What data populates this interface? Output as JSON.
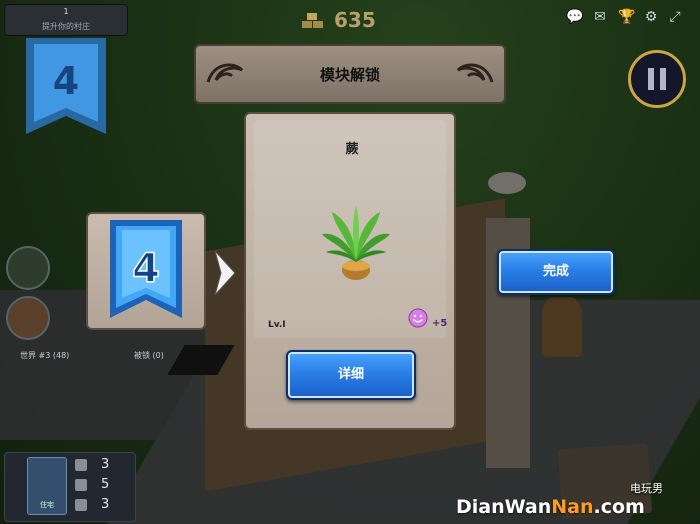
{
  "hud": {
    "level_text": "1",
    "progress_text": "提升你的村庄",
    "coin_amount": "635",
    "icons": [
      "chat-icon",
      "mail-icon",
      "trophy-icon",
      "gear-icon",
      "expand-icon"
    ],
    "timer_icon": "pause-icon"
  },
  "side": {
    "ribbon_level": "4",
    "stats_left": "世界 #3 (48)",
    "stats_right": "被锁 (0)"
  },
  "bottom_panel": {
    "label": "住宅",
    "counts": [
      "3",
      "5",
      "3"
    ]
  },
  "modal": {
    "title": "模块解锁",
    "unlock_level": "4",
    "item_name": "蕨",
    "item_level": "Lv.Ⅰ",
    "bonus": "+5",
    "detail_label": "详细",
    "done_label": "完成"
  },
  "watermark": {
    "part1": "DianWan",
    "part2": "Nan",
    "part3": ".com",
    "site_label": "电玩男"
  },
  "colors": {
    "button_blue": "#2a7fe6",
    "ribbon_blue": "#3aa0ff",
    "card_tan": "#c2b6aa",
    "watermark_accent": "#ff9b2a"
  }
}
